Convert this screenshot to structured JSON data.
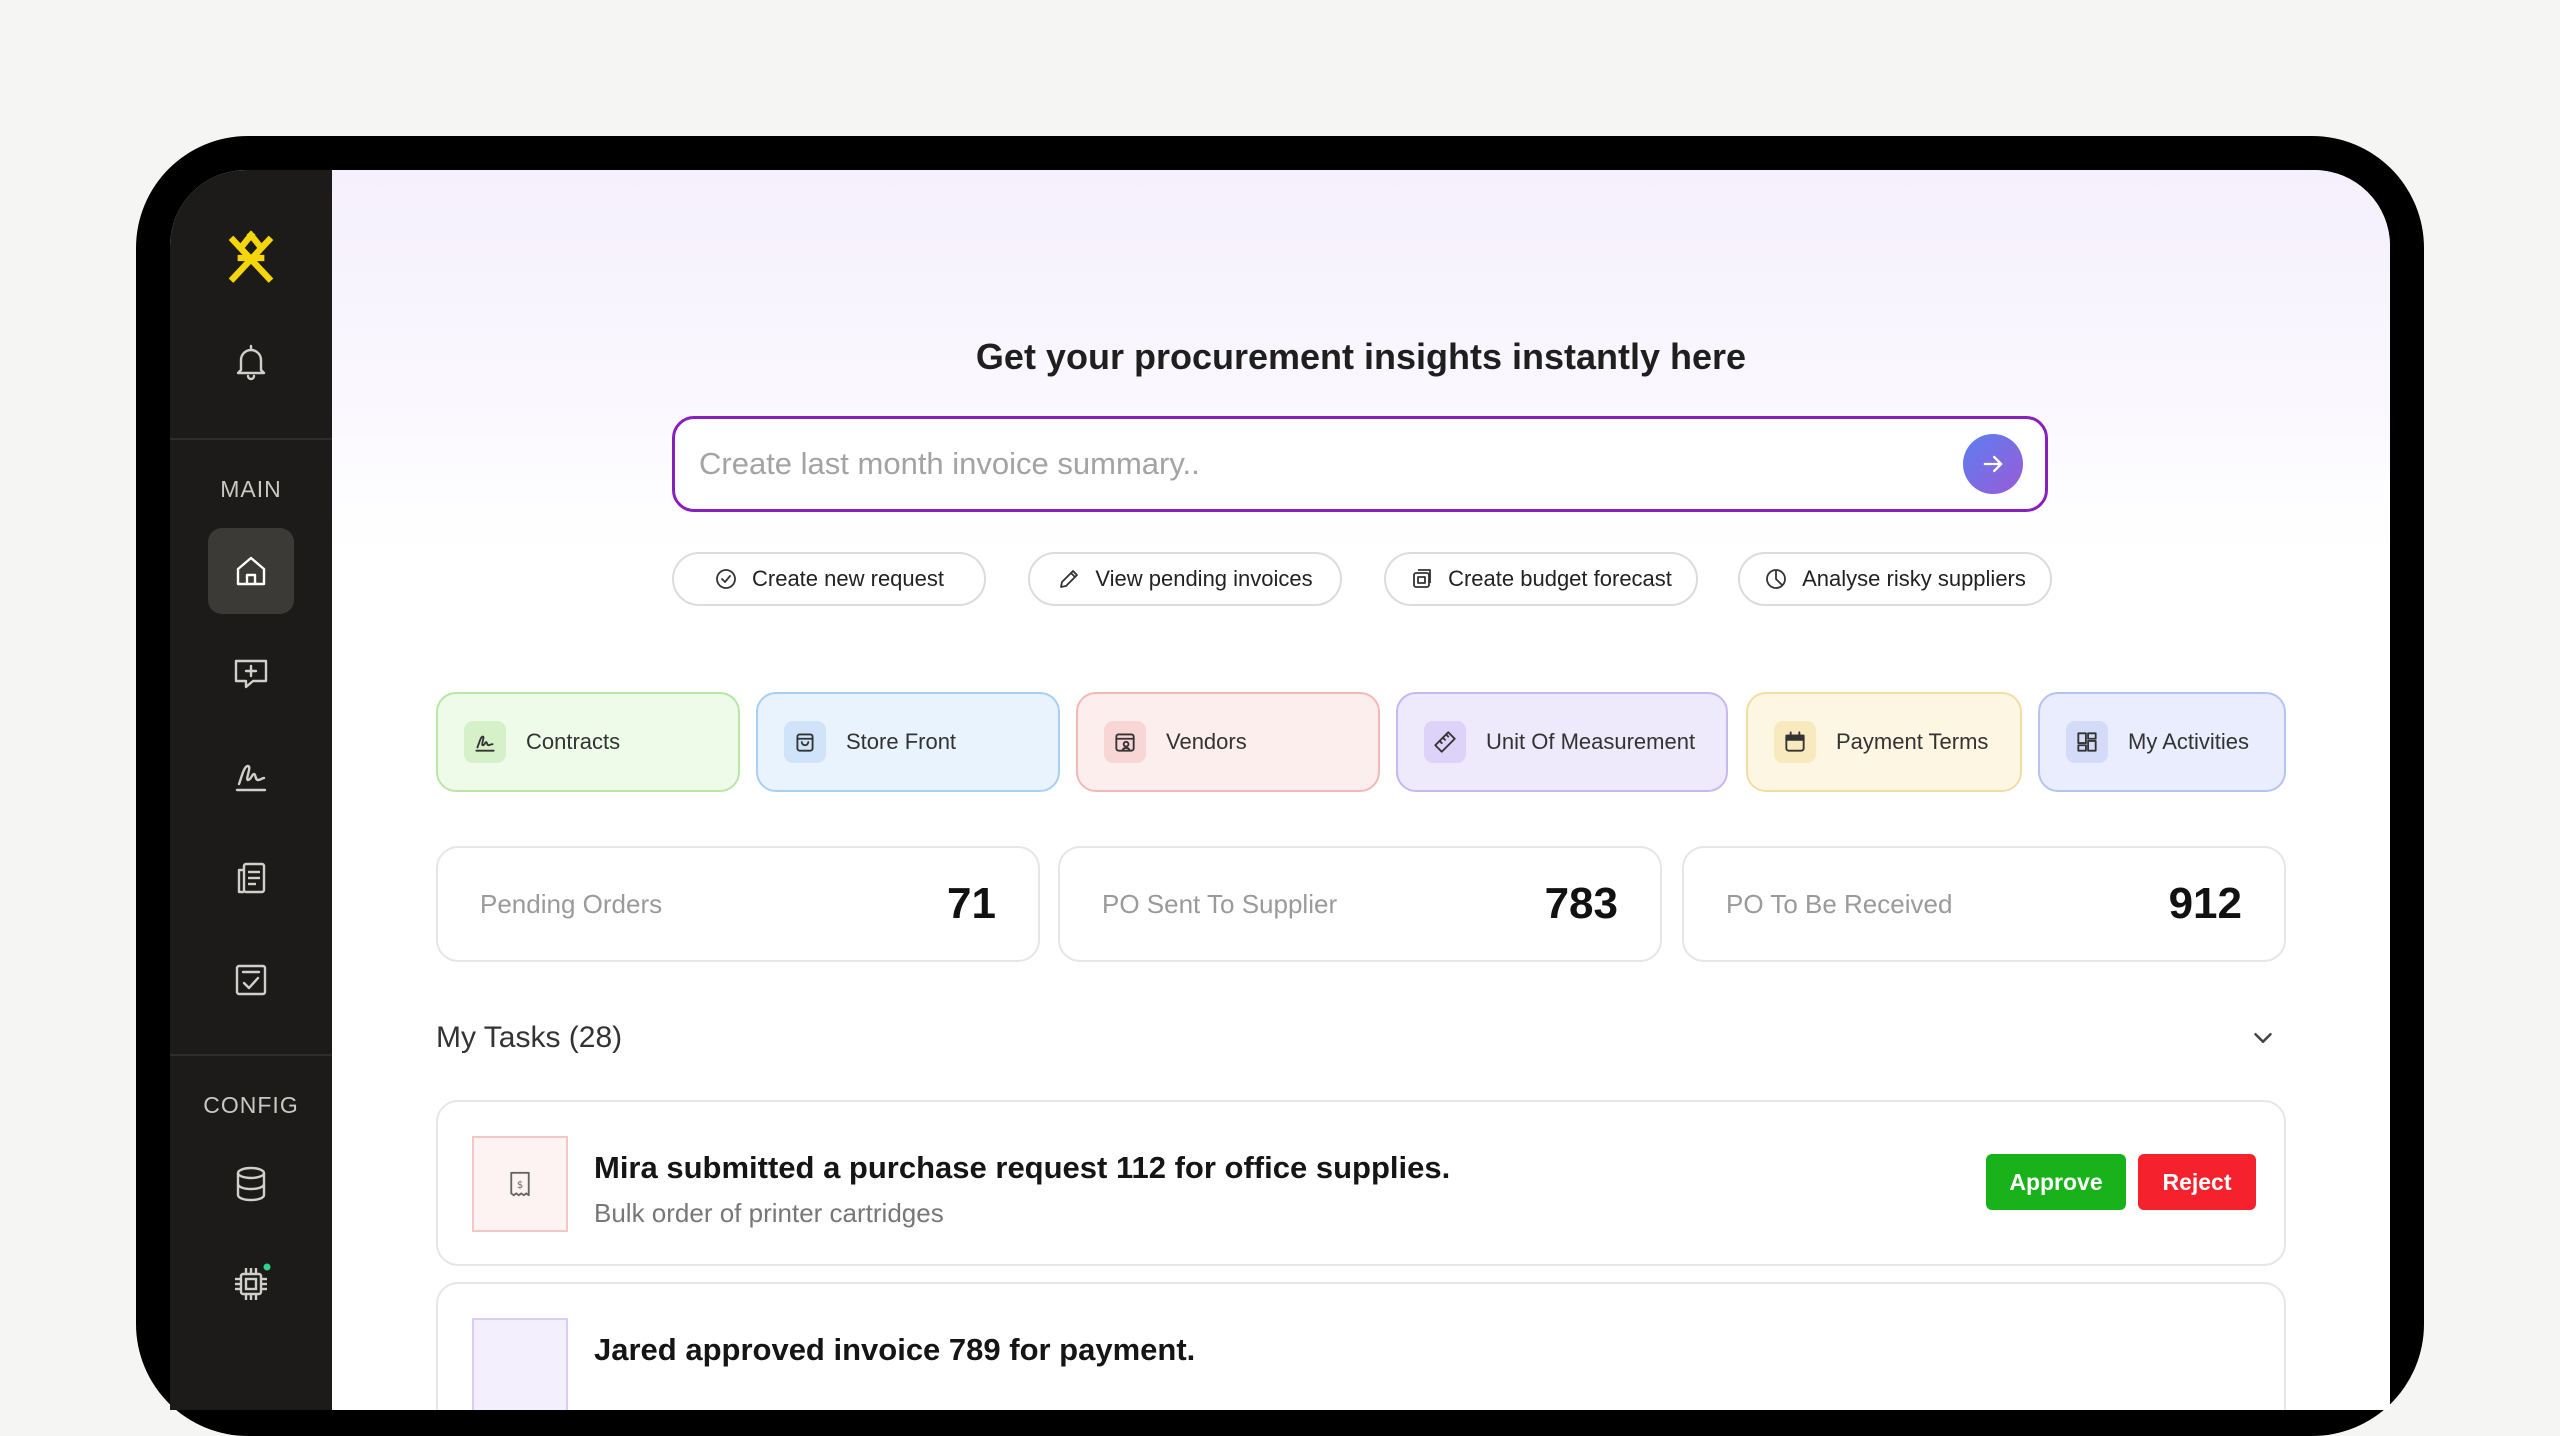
{
  "sidebar": {
    "logo_icon": "brand-logo",
    "main_label": "MAIN",
    "config_label": "CONFIG",
    "colors": {
      "background": "#1c1b19",
      "logo": "#f5d60a",
      "status_dot": "#2fd38a"
    },
    "items": [
      {
        "name": "bell-icon"
      },
      {
        "name": "home-icon",
        "active": true
      },
      {
        "name": "chat-add-icon"
      },
      {
        "name": "signature-icon"
      },
      {
        "name": "document-stack-icon"
      },
      {
        "name": "checklist-icon"
      },
      {
        "name": "database-icon"
      },
      {
        "name": "chip-icon"
      }
    ]
  },
  "hero": {
    "headline": "Get your procurement insights instantly here",
    "search_placeholder": "Create last month invoice summary..",
    "search_value": ""
  },
  "quick_actions": [
    {
      "label": "Create new request",
      "icon": "check-circle-icon"
    },
    {
      "label": "View pending invoices",
      "icon": "pencil-icon"
    },
    {
      "label": "Create budget forecast",
      "icon": "budget-icon"
    },
    {
      "label": "Analyse risky suppliers",
      "icon": "pie-chart-icon"
    }
  ],
  "tiles": [
    {
      "label": "Contracts",
      "icon": "signature-icon",
      "bg": "#eefbe8",
      "border": "#b9e6a6",
      "icon_bg": "#d6f0ca"
    },
    {
      "label": "Store Front",
      "icon": "shopping-bag-icon",
      "bg": "#e8f3fd",
      "border": "#a9cff3",
      "icon_bg": "#cfe4f8"
    },
    {
      "label": "Vendors",
      "icon": "vendor-icon",
      "bg": "#fdeeee",
      "border": "#f2b8b8",
      "icon_bg": "#f8d6d6"
    },
    {
      "label": "Unit Of Measurement",
      "icon": "ruler-icon",
      "bg": "#efe9fc",
      "border": "#c8b8f0",
      "icon_bg": "#ddd2f7"
    },
    {
      "label": "Payment Terms",
      "icon": "calendar-icon",
      "bg": "#fdf6e3",
      "border": "#f1dda4",
      "icon_bg": "#f8e9bf"
    },
    {
      "label": "My Activities",
      "icon": "dashboard-icon",
      "bg": "#e9edfd",
      "border": "#b5c3f3",
      "icon_bg": "#d3dbf8"
    }
  ],
  "stats": [
    {
      "label": "Pending Orders",
      "value": "71"
    },
    {
      "label": "PO Sent To Supplier",
      "value": "783"
    },
    {
      "label": "PO To Be Received",
      "value": "912"
    }
  ],
  "tasks": {
    "header": "My Tasks (28)",
    "items": [
      {
        "title": "Mira submitted a purchase request 112 for office supplies.",
        "subtitle": "Bulk order of printer cartridges",
        "approve_label": "Approve",
        "reject_label": "Reject"
      },
      {
        "title": "Jared approved invoice 789 for payment."
      }
    ]
  },
  "colors": {
    "search_border": "#8a1fc0",
    "approve": "#1ab21a",
    "reject": "#f5222d"
  }
}
